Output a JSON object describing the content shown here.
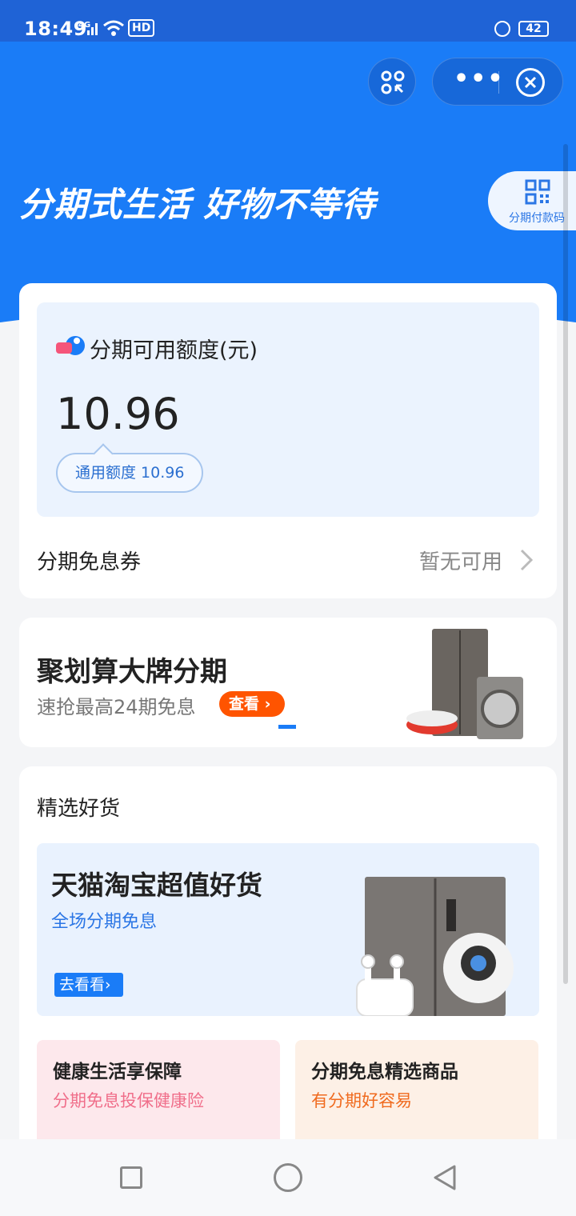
{
  "status_bar": {
    "time": "18:49",
    "signal": "4G",
    "hd": "HD",
    "battery": "42"
  },
  "header": {
    "slogan": "分期式生活  好物不等待",
    "pay_code_label": "分期付款码"
  },
  "credit": {
    "title": "分期可用额度(元)",
    "amount": "10.96",
    "general_label": "通用额度 10.96"
  },
  "coupon": {
    "label": "分期免息券",
    "status": "暂无可用"
  },
  "promo": {
    "title": "聚划算大牌分期",
    "subtitle": "速抢最高24期免息",
    "button": "查看"
  },
  "goods": {
    "heading": "精选好货",
    "banner_title": "天猫淘宝超值好货",
    "banner_sub": "全场分期免息",
    "banner_button": "去看看"
  },
  "tiles": [
    {
      "title": "健康生活享保障",
      "subtitle": "分期免息投保健康险"
    },
    {
      "title": "分期免息精选商品",
      "subtitle": "有分期好容易"
    }
  ],
  "colors": {
    "primary": "#1a7cf7",
    "accent": "#ff5400"
  }
}
